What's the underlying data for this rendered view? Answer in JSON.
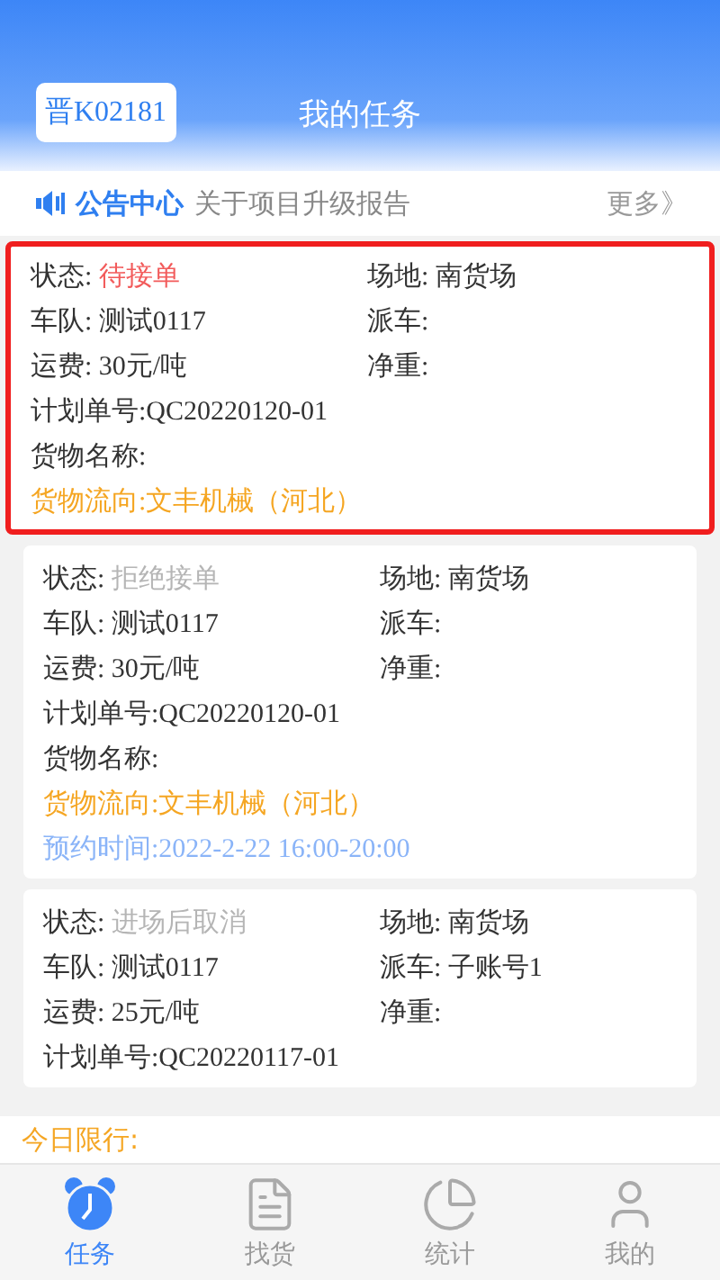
{
  "header": {
    "plate": "晋K02181",
    "title": "我的任务"
  },
  "notice": {
    "title": "公告中心",
    "text": "关于项目升级报告",
    "more": "更多》"
  },
  "cards": [
    {
      "selected": true,
      "status": {
        "label": "状态:",
        "value": "待接单",
        "color": "#f25b5b"
      },
      "rows": [
        {
          "kind": "pair",
          "left": "车队: 测试0117",
          "right": "派车:"
        },
        {
          "kind": "pair",
          "left": "运费: 30元/吨",
          "right": "净重:"
        },
        {
          "kind": "line",
          "text": "计划单号:QC20220120-01"
        },
        {
          "kind": "line",
          "text": "货物名称:"
        },
        {
          "kind": "flow",
          "text": "货物流向:文丰机械（河北）"
        }
      ],
      "site": "场地: 南货场"
    },
    {
      "selected": false,
      "status": {
        "label": "状态:",
        "value": "拒绝接单",
        "color": "#b5b5b5"
      },
      "rows": [
        {
          "kind": "pair",
          "left": "车队: 测试0117",
          "right": "派车:"
        },
        {
          "kind": "pair",
          "left": "运费: 30元/吨",
          "right": "净重:"
        },
        {
          "kind": "line",
          "text": "计划单号:QC20220120-01"
        },
        {
          "kind": "line",
          "text": "货物名称:"
        },
        {
          "kind": "flow",
          "text": "货物流向:文丰机械（河北）"
        },
        {
          "kind": "time",
          "text": "预约时间:2022-2-22 16:00-20:00"
        }
      ],
      "site": "场地: 南货场"
    },
    {
      "selected": false,
      "status": {
        "label": "状态:",
        "value": "进场后取消",
        "color": "#b5b5b5"
      },
      "rows": [
        {
          "kind": "pair",
          "left": "车队: 测试0117",
          "right": "派车: 子账号1"
        },
        {
          "kind": "pair",
          "left": "运费: 25元/吨",
          "right": "净重:"
        },
        {
          "kind": "line",
          "text": "计划单号:QC20220117-01"
        }
      ],
      "site": "场地: 南货场"
    }
  ],
  "limit": "今日限行:",
  "tabs": [
    {
      "label": "任务",
      "kind": "clock",
      "selected": true
    },
    {
      "label": "找货",
      "kind": "document",
      "selected": false
    },
    {
      "label": "统计",
      "kind": "chart",
      "selected": false
    },
    {
      "label": "我的",
      "kind": "user",
      "selected": false
    }
  ]
}
